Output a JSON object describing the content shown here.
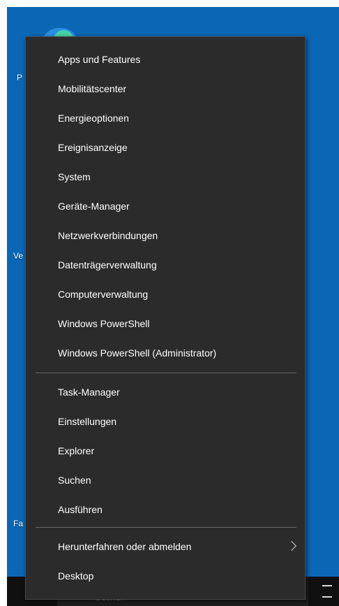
{
  "desktop": {
    "labels": [
      "P",
      "Ve",
      "Fa"
    ]
  },
  "taskbar": {
    "search_text": "Suchen"
  },
  "menu": {
    "group1": [
      "Apps und Features",
      "Mobilitätscenter",
      "Energieoptionen",
      "Ereignisanzeige",
      "System",
      "Geräte-Manager",
      "Netzwerkverbindungen",
      "Datenträgerverwaltung",
      "Computerverwaltung",
      "Windows PowerShell",
      "Windows PowerShell (Administrator)"
    ],
    "group2": [
      "Task-Manager",
      "Einstellungen",
      "Explorer",
      "Suchen",
      "Ausführen"
    ],
    "group3": [
      "Herunterfahren oder abmelden",
      "Desktop"
    ]
  },
  "colors": {
    "menu_bg": "#2b2b2b",
    "desktop_bg": "#0a67b5",
    "separator": "#6a6a6a"
  }
}
